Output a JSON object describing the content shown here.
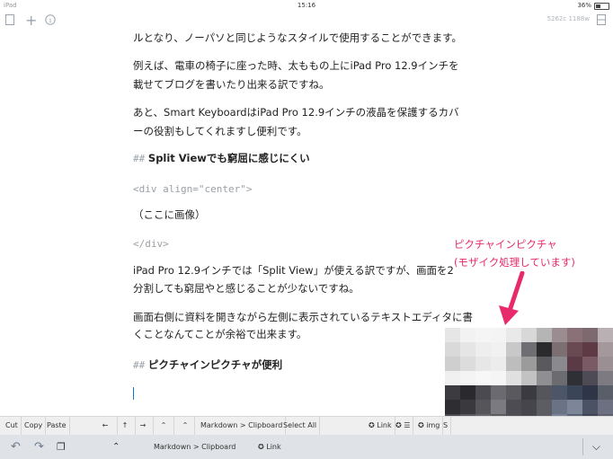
{
  "status": {
    "device": "iPad",
    "time": "15:16",
    "battery": "36%"
  },
  "topbar": {
    "word_count": "5262c 1188w"
  },
  "editor": {
    "lines": [
      "ルとなり、ノーパソと同じようなスタイルで使用することができます。",
      "例えば、電車の椅子に座った時、太ももの上にiPad Pro 12.9インチを",
      "載せてブログを書いたり出来る訳ですね。",
      "あと、Smart KeyboardはiPad Pro 12.9インチの液晶を保護するカバ",
      "ーの役割もしてくれますし便利です。"
    ],
    "heading1_marker": "##",
    "heading1_text": "Split Viewでも窮屈に感じにくい",
    "div_open": "<div align=\"center\">",
    "image_placeholder": "（ここに画像）",
    "div_close": "</div>",
    "lines2": [
      "iPad Pro 12.9インチでは「Split View」が使える訳ですが、画面を2",
      "分割しても窮屈やと感じることが少ないですね。",
      "画面右側に資料を開きながら左側に表示されているテキストエディタに書",
      "くことなんてことが余裕で出来ます。"
    ],
    "heading2_marker": "##",
    "heading2_text": "ピクチャインピクチャが便利"
  },
  "annotation": {
    "line1": "ピクチャインピクチャ",
    "line2": "(モザイク処理しています)",
    "color": "#e8296b"
  },
  "toolbar": {
    "cut": "Cut",
    "copy": "Copy",
    "paste": "Paste",
    "left": "←",
    "up": "↑",
    "right": "→",
    "caret": "⌃",
    "caret2": "⌃",
    "md_clipboard": "Markdown > Clipboard",
    "select_all": "Select All",
    "link": "✪ Link",
    "list": "✪ ☰",
    "img": "✪ img",
    "s": "S"
  },
  "keyboard_bar": {
    "undo": "↶",
    "redo": "↷",
    "paste_icon": "❐",
    "caret": "⌃",
    "md_clipboard": "Markdown > Clipboard",
    "link": "✪ Link",
    "collapse": "⌵"
  },
  "mosaic_colors": [
    "#e6e6e6",
    "#f2f2f2",
    "#f5f5f5",
    "#f4f4f4",
    "#e9e9e9",
    "#d8d8d8",
    "#b5b5b5",
    "#9a8c90",
    "#8a7178",
    "#7d6a70",
    "#b8b0b3",
    "#d9d9d9",
    "#e5e5e5",
    "#eeeeee",
    "#f1f1f1",
    "#c8c8c8",
    "#6f6f73",
    "#2b2b2e",
    "#7c6f72",
    "#6a4a52",
    "#5e3b44",
    "#a4989c",
    "#cfcfcf",
    "#dcdcdc",
    "#e7e7e7",
    "#ececec",
    "#bdbdbd",
    "#9b9b9b",
    "#5a5a5e",
    "#8a8a8e",
    "#5a3a44",
    "#7a5a64",
    "#9a9094",
    "#f0f0f0",
    "#f4f4f4",
    "#f7f7f7",
    "#f5f5f5",
    "#e0e0e0",
    "#c2c2c2",
    "#8f8f93",
    "#6b6b70",
    "#2f3036",
    "#4e4a56",
    "#7e7a82",
    "#3c3c40",
    "#2a2a2e",
    "#4a4a50",
    "#6a6a70",
    "#5a5a5e",
    "#3a3a40",
    "#55555c",
    "#4d5668",
    "#3b4558",
    "#2f3546",
    "#5a5e68",
    "#2e2e32",
    "#3a3a3e",
    "#55555a",
    "#7a7a80",
    "#4c4c52",
    "#45454b",
    "#5c5c63",
    "#6a7385",
    "#7c8698",
    "#4a5264",
    "#6c7080",
    "#4a4a4e",
    "#5a5a5e",
    "#66666b",
    "#5b5b60",
    "#505056",
    "#48484e",
    "#5e5e66",
    "#7a8498",
    "#5a6276",
    "#3e4456",
    "#5c6070"
  ]
}
